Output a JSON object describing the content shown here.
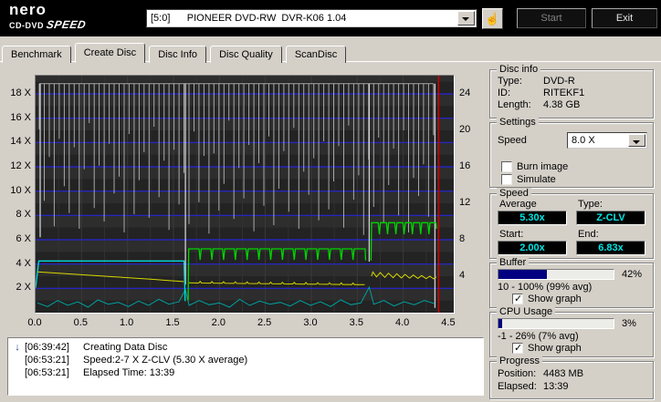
{
  "app": {
    "logo": {
      "line1": "nero",
      "line2a": "CD-DVD",
      "line2b": "SPEED"
    },
    "drive_selector": {
      "value": "[5:0]      PIONEER DVD-RW  DVR-K06 1.04"
    },
    "buttons": {
      "start": "Start",
      "exit": "Exit"
    },
    "hand_icon": "☝"
  },
  "tabs": {
    "items": [
      {
        "label": "Benchmark"
      },
      {
        "label": "Create Disc"
      },
      {
        "label": "Disc Info"
      },
      {
        "label": "Disc Quality"
      },
      {
        "label": "ScanDisc"
      }
    ],
    "selected": "Create Disc"
  },
  "chart_data": {
    "type": "line",
    "x_axis": {
      "unit": "GB",
      "min": 0,
      "max": 4.55,
      "ticks": [
        0,
        0.5,
        1,
        1.5,
        2,
        2.5,
        3,
        3.5,
        4,
        4.5
      ]
    },
    "y_left": {
      "ticks": [
        2,
        4,
        6,
        8,
        10,
        12,
        14,
        16,
        18
      ],
      "suffix": " X",
      "max": 19.5
    },
    "y_right": {
      "ticks": [
        4,
        8,
        12,
        16,
        20,
        24
      ],
      "max": 26
    },
    "colors": {
      "grid": "#2626d8",
      "background": "#262626"
    },
    "series": {
      "buffer": {
        "name": "buffer-level",
        "color": "#a8a8a8",
        "baseline": 18.85,
        "x0": 0.04,
        "x1": 4.33,
        "depths": [
          15.1,
          9.2,
          12.8,
          7.1,
          14.3,
          10.4,
          8.2,
          13.6,
          6.9,
          11.8,
          15.6,
          8.6,
          12.1,
          7.5,
          13.9,
          9.8,
          11.2,
          6.6,
          14.7,
          8.1,
          10.9,
          13.2,
          7.8,
          15.3,
          9.5,
          12.5,
          6.8,
          13.4,
          8.9,
          11.5,
          7.3,
          14.9,
          9.1,
          12.9,
          6.5,
          13.1,
          8.4,
          10.6,
          15.8,
          7.7,
          11.9,
          9.4,
          13.8,
          6.7,
          12.3,
          8.8,
          14.5,
          7.2,
          10.2,
          13.3,
          8.3,
          15.2,
          6.9,
          11.6,
          9.7,
          12.7,
          7.6,
          14.1,
          8.5,
          10.8,
          13.7,
          7.0,
          15.4,
          9.3,
          11.3,
          6.4,
          12.6,
          8.7,
          14.4,
          7.4,
          10.5,
          13.5,
          8.0,
          15.0,
          6.6,
          11.1,
          9.6,
          12.2,
          7.9,
          14.6
        ]
      },
      "buffer_deep": {
        "color": "#d0d0d0",
        "spikes": [
          [
            0.05,
            6.2
          ],
          [
            1.63,
            2.3
          ],
          [
            3.63,
            4.2
          ],
          [
            4.345,
            0.4
          ]
        ]
      },
      "write_speed": [
        {
          "zone": "1",
          "color": "#00dcdc",
          "points": [
            [
              0,
              2.05
            ],
            [
              0.035,
              4.25
            ],
            [
              1.615,
              4.25
            ],
            [
              1.627,
              0.95
            ]
          ]
        },
        {
          "zone": "2",
          "color": "#00d400",
          "level": 5.25,
          "dip_level": 4.35,
          "x0": 1.66,
          "x1": 3.585,
          "start_y": 1.0,
          "end_y": 4.3,
          "dips": [
            1.79,
            1.918,
            2.046,
            2.174,
            2.302,
            2.43,
            2.558,
            2.686,
            2.814,
            2.942,
            3.07,
            3.198,
            3.326,
            3.454
          ]
        },
        {
          "zone": "3",
          "color": "#00d400",
          "level": 7.4,
          "dip_level": 6.45,
          "x0": 3.65,
          "x1": 4.355,
          "start_y": 4.3,
          "end_y": 6.9,
          "dips": [
            3.74,
            3.83,
            3.92,
            4.01,
            4.1,
            4.19,
            4.28
          ]
        }
      ],
      "rpm": {
        "color": "#d8d800",
        "segments": [
          {
            "points": [
              [
                0.02,
                3.35
              ],
              [
                0.25,
                3.25
              ],
              [
                0.5,
                3.12
              ],
              [
                0.75,
                3.0
              ],
              [
                1.0,
                2.88
              ],
              [
                1.25,
                2.75
              ],
              [
                1.5,
                2.62
              ],
              [
                1.61,
                2.56
              ]
            ]
          },
          {
            "x0": 1.66,
            "y0": 2.45,
            "x1": 3.58,
            "y1": 2.3,
            "bump_h": 0.13,
            "bump_xs": [
              1.79,
              1.918,
              2.046,
              2.174,
              2.302,
              2.43,
              2.558,
              2.686,
              2.814,
              2.942,
              3.07,
              3.198,
              3.326,
              3.454
            ]
          },
          {
            "points": [
              [
                3.655,
                3.0
              ],
              [
                3.67,
                3.35
              ],
              [
                3.71,
                2.95
              ],
              [
                3.75,
                3.3
              ],
              [
                3.8,
                2.9
              ],
              [
                3.84,
                3.25
              ],
              [
                3.89,
                2.88
              ],
              [
                3.93,
                3.2
              ],
              [
                3.98,
                2.86
              ],
              [
                4.02,
                3.15
              ],
              [
                4.07,
                2.84
              ],
              [
                4.11,
                3.1
              ],
              [
                4.16,
                2.82
              ],
              [
                4.2,
                3.05
              ],
              [
                4.25,
                2.8
              ],
              [
                4.29,
                3.0
              ],
              [
                4.33,
                2.78
              ],
              [
                4.36,
                2.95
              ]
            ]
          }
        ]
      },
      "cpu": {
        "color": "#00a0a0",
        "points": [
          [
            0.02,
            0.8
          ],
          [
            0.13,
            0.5
          ],
          [
            0.24,
            1.0
          ],
          [
            0.35,
            0.6
          ],
          [
            0.46,
            0.9
          ],
          [
            0.57,
            0.45
          ],
          [
            0.68,
            1.05
          ],
          [
            0.79,
            0.7
          ],
          [
            0.9,
            0.85
          ],
          [
            1.01,
            0.5
          ],
          [
            1.12,
            0.95
          ],
          [
            1.23,
            0.6
          ],
          [
            1.34,
            1.1
          ],
          [
            1.45,
            0.7
          ],
          [
            1.56,
            0.9
          ],
          [
            1.63,
            1.9
          ],
          [
            1.67,
            0.6
          ],
          [
            1.78,
            1.0
          ],
          [
            1.89,
            0.65
          ],
          [
            2.0,
            0.8
          ],
          [
            2.11,
            0.45
          ],
          [
            2.22,
            1.1
          ],
          [
            2.33,
            0.6
          ],
          [
            2.44,
            0.95
          ],
          [
            2.55,
            0.7
          ],
          [
            2.66,
            0.85
          ],
          [
            2.77,
            0.55
          ],
          [
            2.88,
            1.0
          ],
          [
            2.99,
            0.6
          ],
          [
            3.1,
            0.9
          ],
          [
            3.21,
            0.5
          ],
          [
            3.32,
            1.05
          ],
          [
            3.43,
            0.65
          ],
          [
            3.54,
            0.8
          ],
          [
            3.63,
            2.1
          ],
          [
            3.68,
            0.7
          ],
          [
            3.79,
            1.0
          ],
          [
            3.9,
            0.55
          ],
          [
            4.01,
            0.9
          ],
          [
            4.12,
            0.65
          ],
          [
            4.23,
            1.0
          ],
          [
            4.34,
            0.75
          ]
        ]
      }
    },
    "cursor": {
      "x": 4.385,
      "color": "#d40000"
    }
  },
  "log": {
    "lines": [
      {
        "icon": "↓",
        "time": "[06:39:42]",
        "text": "Creating Data Disc"
      },
      {
        "icon": "",
        "time": "[06:53:21]",
        "text": "Speed:2-7 X Z-CLV (5.30 X average)"
      },
      {
        "icon": "",
        "time": "[06:53:21]",
        "text": "Elapsed Time: 13:39"
      }
    ]
  },
  "panel": {
    "disc_info": {
      "title": "Disc info",
      "type_label": "Type:",
      "type_value": "DVD-R",
      "id_label": "ID:",
      "id_value": "RITEKF1",
      "length_label": "Length:",
      "length_value": "4.38 GB"
    },
    "settings": {
      "title": "Settings",
      "speed_label": "Speed",
      "speed_value": "8.0 X",
      "burn_image_label": "Burn image",
      "burn_image_checked": false,
      "simulate_label": "Simulate",
      "simulate_checked": false
    },
    "speed": {
      "title": "Speed",
      "average_label": "Average",
      "average_value": "5.30x",
      "type_label": "Type:",
      "type_value": "Z-CLV",
      "start_label": "Start:",
      "start_value": "2.00x",
      "end_label": "End:",
      "end_value": "6.83x",
      "value_color": "#00e5e5"
    },
    "buffer": {
      "title": "Buffer",
      "percent_value": 42,
      "percent_label": "42%",
      "range_text": "10 - 100% (99% avg)",
      "show_graph_label": "Show graph",
      "show_graph_checked": true
    },
    "cpu": {
      "title": "CPU Usage",
      "percent_value": 3,
      "percent_label": "3%",
      "range_text": "-1 - 26% (7% avg)",
      "show_graph_label": "Show graph",
      "show_graph_checked": true
    },
    "progress": {
      "title": "Progress",
      "position_label": "Position:",
      "position_value": "4483 MB",
      "elapsed_label": "Elapsed:",
      "elapsed_value": "13:39"
    }
  }
}
